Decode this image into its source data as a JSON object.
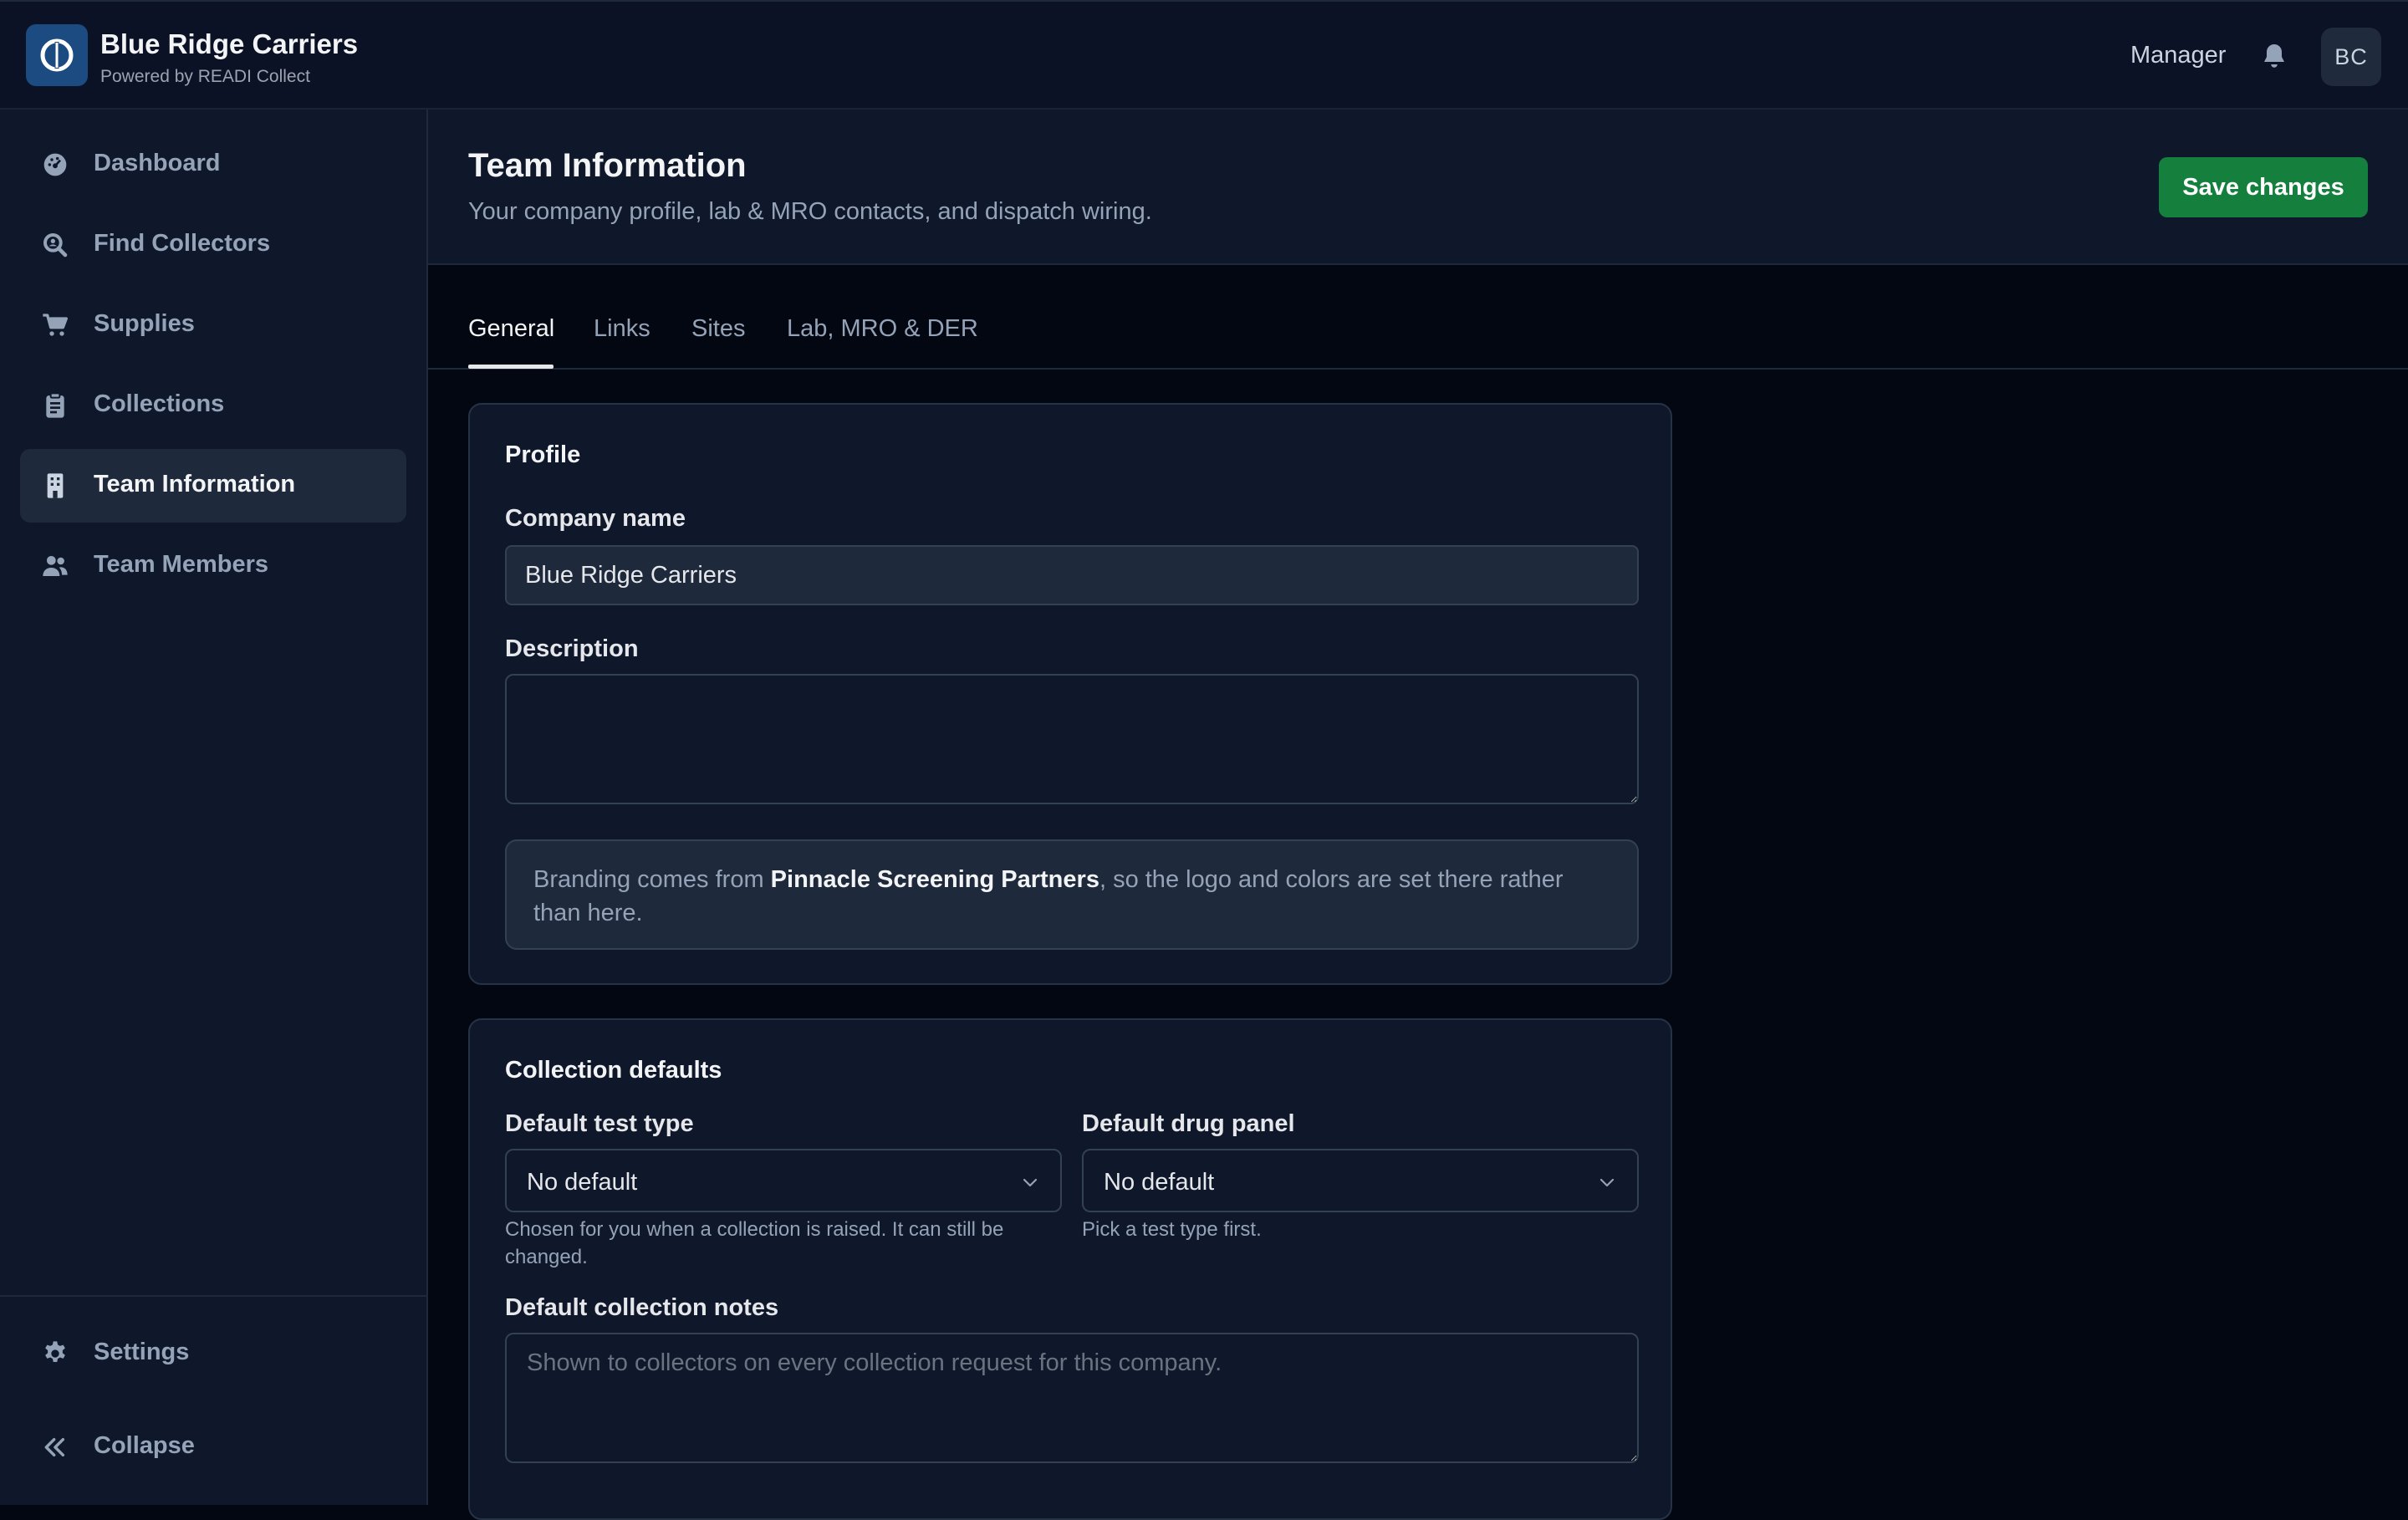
{
  "app": {
    "name": "Blue Ridge Carriers",
    "subtitle": "Powered by READI Collect"
  },
  "topbar": {
    "role": "Manager",
    "avatar_initials": "BC",
    "bell_icon": "bell-icon"
  },
  "sidebar": {
    "items": [
      {
        "label": "Dashboard",
        "icon": "gauge-icon"
      },
      {
        "label": "Find Collectors",
        "icon": "search-icon"
      },
      {
        "label": "Supplies",
        "icon": "cart-icon"
      },
      {
        "label": "Collections",
        "icon": "clipboard-icon"
      },
      {
        "label": "Team Information",
        "icon": "building-icon",
        "active": true
      },
      {
        "label": "Team Members",
        "icon": "users-icon"
      }
    ],
    "footer": [
      {
        "label": "Settings",
        "icon": "gear-icon"
      },
      {
        "label": "Collapse",
        "icon": "chevrons-left-icon"
      }
    ]
  },
  "header": {
    "title": "Team Information",
    "subtitle": "Your company profile, lab & MRO contacts, and dispatch wiring.",
    "save_label": "Save changes"
  },
  "tabs": [
    {
      "label": "General",
      "active": true
    },
    {
      "label": "Links"
    },
    {
      "label": "Sites"
    },
    {
      "label": "Lab, MRO & DER"
    }
  ],
  "profile": {
    "title": "Profile",
    "company_label": "Company name",
    "company_value": "Blue Ridge Carriers",
    "description_label": "Description",
    "description_value": "",
    "branding_prefix": "Branding comes from ",
    "branding_org": "Pinnacle Screening Partners",
    "branding_suffix": ", so the logo and colors are set there rather than here."
  },
  "collection_defaults": {
    "title": "Collection defaults",
    "test_type_label": "Default test type",
    "test_type_value": "No default",
    "test_type_help": "Chosen for you when a collection is raised. It can still be changed.",
    "drug_panel_label": "Default drug panel",
    "drug_panel_value": "No default",
    "drug_panel_help": "Pick a test type first.",
    "notes_label": "Default collection notes",
    "notes_placeholder": "Shown to collectors on every collection request for this company."
  },
  "colors": {
    "accent_green": "#15803d",
    "brand_blue": "#1b4b80",
    "background": "#030712",
    "panel": "#0f172a"
  }
}
